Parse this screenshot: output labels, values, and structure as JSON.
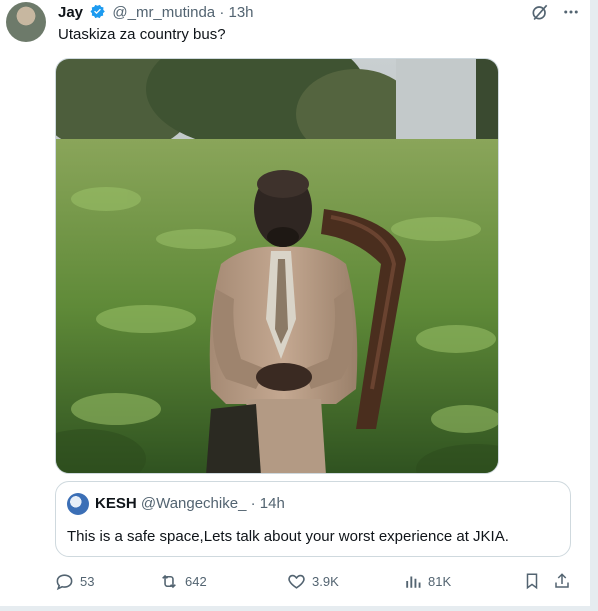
{
  "tweet": {
    "author_name": "Jay",
    "author_handle": "@_mr_mutinda",
    "separator": "·",
    "time": "13h",
    "text": "Utaskiza za country bus?",
    "verified_color": "#1d9bf0"
  },
  "header_icons": [
    "grok-icon",
    "more-icon"
  ],
  "quote": {
    "author_name": "KESH",
    "author_handle": "@Wangechike_",
    "separator": "·",
    "time": "14h",
    "text": "This is a safe space,Lets talk about your worst experience at JKIA."
  },
  "actions": {
    "replies": "53",
    "reposts": "642",
    "likes": "3.9K",
    "views": "81K"
  },
  "colors": {
    "text": "#0f1419",
    "secondary": "#536471",
    "border": "#cfd9de"
  }
}
